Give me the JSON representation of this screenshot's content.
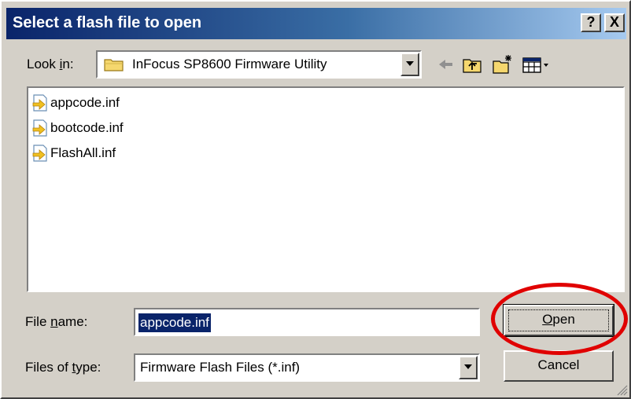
{
  "window": {
    "title": "Select a flash file to open",
    "help_label": "?",
    "close_label": "X"
  },
  "look_in": {
    "label_prefix": "Look ",
    "label_accel": "i",
    "label_suffix": "n:",
    "value": "InFocus SP8600 Firmware Utility",
    "icon": "folder-icon"
  },
  "toolbar": {
    "icons": [
      "back-arrow-icon",
      "up-folder-icon",
      "new-folder-icon",
      "view-menu-icon"
    ]
  },
  "file_list": {
    "items": [
      {
        "name": "appcode.inf",
        "icon": "inf-file-icon"
      },
      {
        "name": "bootcode.inf",
        "icon": "inf-file-icon"
      },
      {
        "name": "FlashAll.inf",
        "icon": "inf-file-icon"
      }
    ]
  },
  "file_name": {
    "label_prefix": "File ",
    "label_accel": "n",
    "label_suffix": "ame:",
    "value": "appcode.inf"
  },
  "file_type": {
    "label_prefix": "Files of ",
    "label_accel": "t",
    "label_suffix": "ype:",
    "value": "Firmware Flash Files (*.inf)"
  },
  "buttons": {
    "open_accel": "O",
    "open_rest": "pen",
    "cancel": "Cancel"
  },
  "colors": {
    "title_gradient_start": "#0a246a",
    "title_gradient_end": "#a6caf0",
    "annotation": "#e00000",
    "selection": "#0a246a"
  }
}
